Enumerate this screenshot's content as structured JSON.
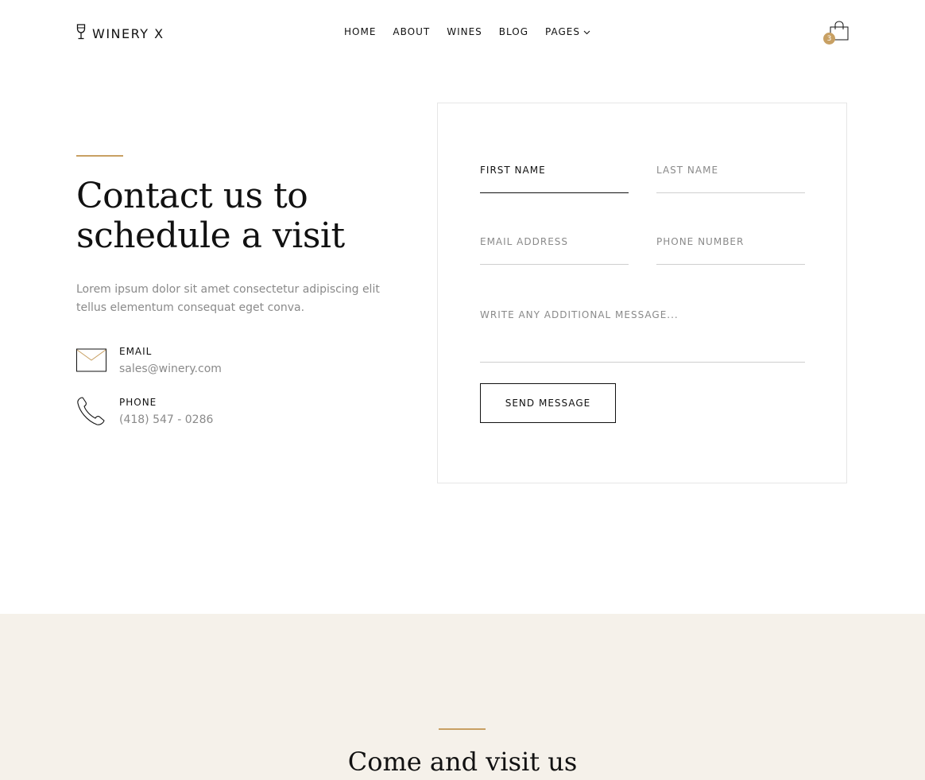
{
  "header": {
    "logo_text": "WINERY X",
    "nav": [
      {
        "label": "HOME"
      },
      {
        "label": "ABOUT"
      },
      {
        "label": "WINES"
      },
      {
        "label": "BLOG"
      },
      {
        "label": "PAGES"
      }
    ],
    "cart_count": "3"
  },
  "contact": {
    "headline": "Contact us to schedule a visit",
    "intro": "Lorem ipsum dolor sit amet consectetur adipiscing elit tellus elementum consequat eget conva.",
    "email_label": "EMAIL",
    "email_value": "sales@winery.com",
    "phone_label": "PHONE",
    "phone_value": "(418) 547 - 0286"
  },
  "form": {
    "first_name_placeholder": "FIRST NAME",
    "last_name_placeholder": "LAST NAME",
    "email_placeholder": "EMAIL ADDRESS",
    "phone_placeholder": "PHONE NUMBER",
    "message_placeholder": "WRITE ANY ADDITIONAL MESSAGE...",
    "send_label": "SEND MESSAGE"
  },
  "visit": {
    "title": "Come and visit us"
  },
  "colors": {
    "accent": "#c8a063",
    "section_bg": "#f5f1ea",
    "muted_text": "#8a8a8a"
  }
}
